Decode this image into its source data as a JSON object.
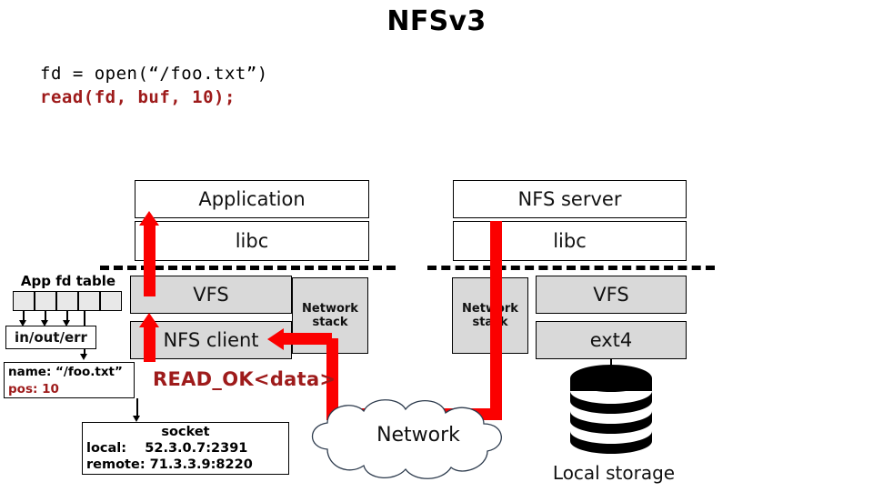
{
  "title": "NFSv3",
  "code": {
    "line1": "fd = open(“/foo.txt”)",
    "line2": "read(fd, buf, 10);"
  },
  "client": {
    "application": "Application",
    "libc": "libc",
    "vfs": "VFS",
    "nfs_client": "NFS client",
    "network_stack": "Network\nstack",
    "network_stack_line1": "Network",
    "network_stack_line2": "stack"
  },
  "server": {
    "nfs_server": "NFS server",
    "libc": "libc",
    "vfs": "VFS",
    "ext4": "ext4",
    "network_stack_line1": "Network",
    "network_stack_line2": "stack",
    "local_storage": "Local storage"
  },
  "fd_table": {
    "title": "App fd table",
    "cells": [
      "",
      "",
      "",
      "",
      ""
    ],
    "in_out_err": "in/out/err",
    "file_object": {
      "name": "name: “/foo.txt”",
      "pos": "pos: 10"
    }
  },
  "socket": {
    "header": "socket",
    "local_label": "local:",
    "local_value": "52.3.0.7:2391",
    "remote_label": "remote:",
    "remote_value": "71.3.3.9:8220",
    "local_row": "local:    52.3.0.7:2391",
    "remote_row": "remote: 71.3.3.9:8220"
  },
  "message": {
    "reply": "READ_OK<data>"
  },
  "network": {
    "label": "Network"
  },
  "colors": {
    "red_path": "#fb0000",
    "dark_red_text": "#9e1b1b",
    "gray_box": "#d9d9d9",
    "black": "#000000"
  }
}
